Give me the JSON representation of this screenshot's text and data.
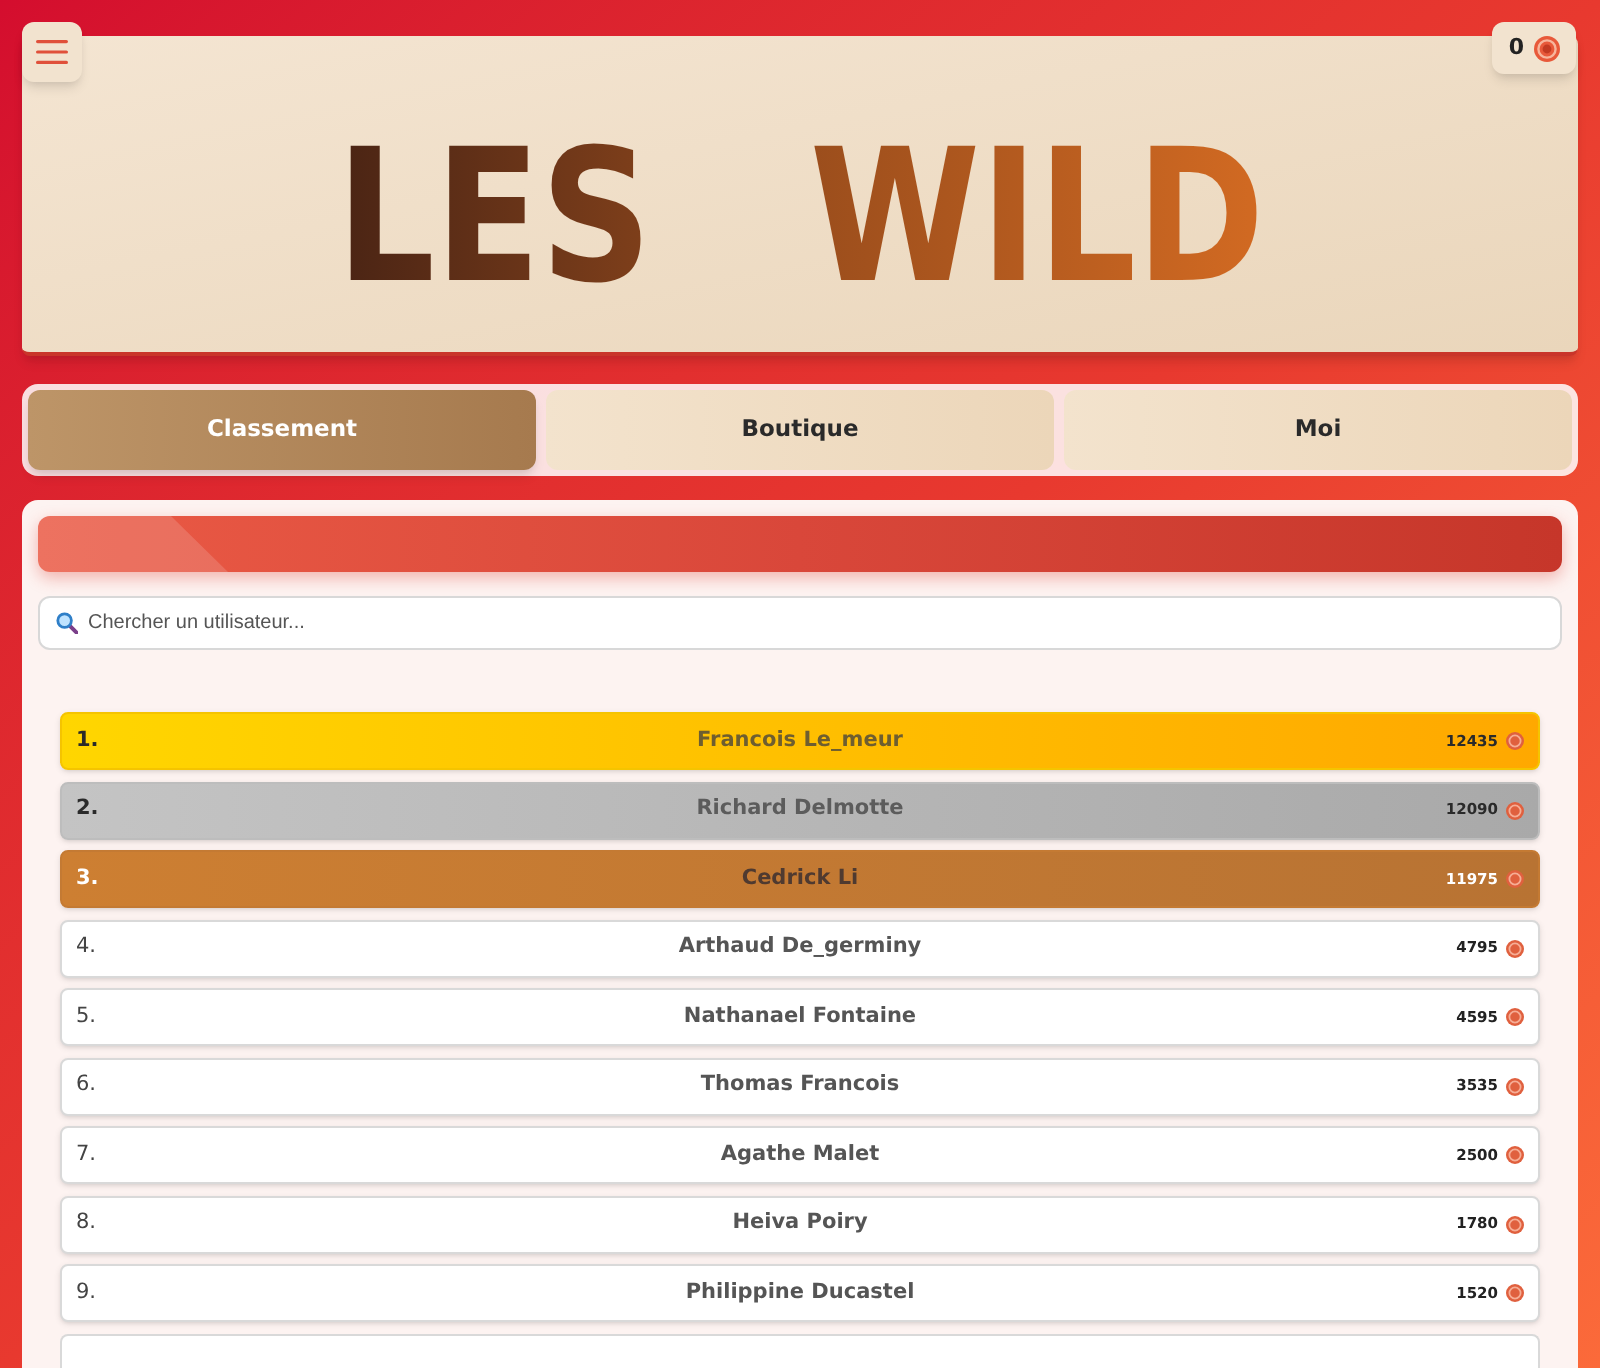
{
  "wallet": {
    "balance": "0"
  },
  "logo": "LES WILD",
  "tabs": [
    {
      "label": "Classement",
      "selected": true
    },
    {
      "label": "Boutique",
      "selected": false
    },
    {
      "label": "Moi",
      "selected": false
    }
  ],
  "search": {
    "placeholder": "Chercher un utilisateur..."
  },
  "leaderboard": {
    "rows": [
      {
        "rank": "1.",
        "name": "Francois Le_meur",
        "score": "12435",
        "kind": "gold"
      },
      {
        "rank": "2.",
        "name": "Richard Delmotte",
        "score": "12090",
        "kind": "silver"
      },
      {
        "rank": "3.",
        "name": "Cedrick Li",
        "score": "11975",
        "kind": "bronze"
      },
      {
        "rank": "4.",
        "name": "Arthaud De_germiny",
        "score": "4795",
        "kind": "plain"
      },
      {
        "rank": "5.",
        "name": "Nathanael Fontaine",
        "score": "4595",
        "kind": "plain"
      },
      {
        "rank": "6.",
        "name": "Thomas Francois",
        "score": "3535",
        "kind": "plain"
      },
      {
        "rank": "7.",
        "name": "Agathe Malet",
        "score": "2500",
        "kind": "plain"
      },
      {
        "rank": "8.",
        "name": "Heiva Poiry",
        "score": "1780",
        "kind": "plain"
      },
      {
        "rank": "9.",
        "name": "Philippine Ducastel",
        "score": "1520",
        "kind": "plain"
      }
    ],
    "more_below": true
  }
}
